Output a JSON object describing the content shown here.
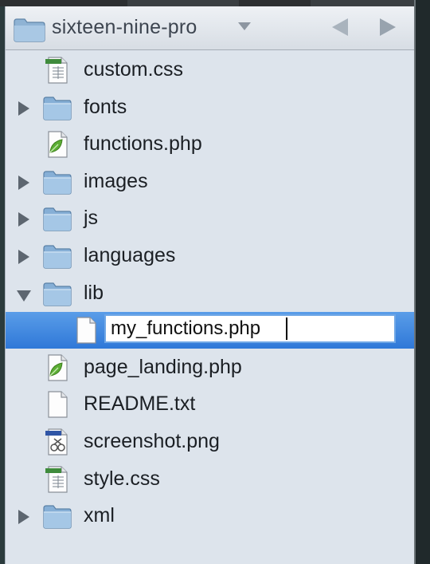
{
  "project": {
    "name": "sixteen-nine-pro"
  },
  "colors": {
    "selection": "#3a86e2",
    "folder": "#8fb8dc",
    "panel_bg": "#dde4ec",
    "php_leaf": "#5cae34"
  },
  "tree": [
    {
      "label": "custom.css",
      "icon": "css-file-icon",
      "type": "file",
      "depth": 0
    },
    {
      "label": "fonts",
      "icon": "folder-icon",
      "type": "folder",
      "expanded": false,
      "depth": 0
    },
    {
      "label": "functions.php",
      "icon": "php-file-icon",
      "type": "file",
      "depth": 0
    },
    {
      "label": "images",
      "icon": "folder-icon",
      "type": "folder",
      "expanded": false,
      "depth": 0
    },
    {
      "label": "js",
      "icon": "folder-icon",
      "type": "folder",
      "expanded": false,
      "depth": 0
    },
    {
      "label": "languages",
      "icon": "folder-icon",
      "type": "folder",
      "expanded": false,
      "depth": 0
    },
    {
      "label": "lib",
      "icon": "folder-icon",
      "type": "folder",
      "expanded": true,
      "depth": 0
    },
    {
      "label": "my_functions.php",
      "icon": "text-file-icon",
      "type": "file",
      "depth": 1,
      "selected": true,
      "editing": true
    },
    {
      "label": "page_landing.php",
      "icon": "php-file-icon",
      "type": "file",
      "depth": 0
    },
    {
      "label": "README.txt",
      "icon": "text-file-icon",
      "type": "file",
      "depth": 0
    },
    {
      "label": "screenshot.png",
      "icon": "image-file-icon",
      "type": "file",
      "depth": 0
    },
    {
      "label": "style.css",
      "icon": "css-file-icon",
      "type": "file",
      "depth": 0
    },
    {
      "label": "xml",
      "icon": "folder-icon",
      "type": "folder",
      "expanded": false,
      "depth": 0
    }
  ]
}
